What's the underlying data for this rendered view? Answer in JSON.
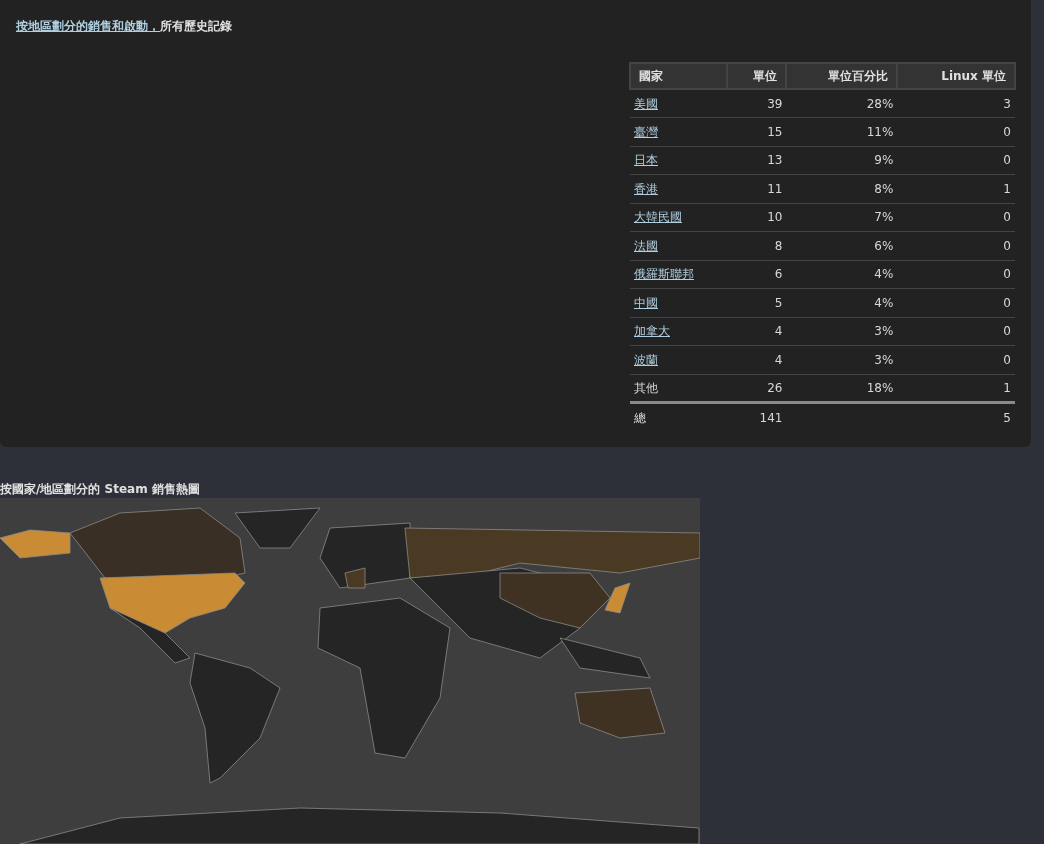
{
  "sales_panel": {
    "title_link": "按地區劃分的銷售和啟動，",
    "title_rest": "所有歷史記錄",
    "table": {
      "columns": [
        "國家",
        "單位",
        "單位百分比",
        "Linux 單位"
      ],
      "rows": [
        {
          "country": "美國",
          "link": true,
          "units": "39",
          "percent": "28%",
          "linux": "3"
        },
        {
          "country": "臺灣",
          "link": true,
          "units": "15",
          "percent": "11%",
          "linux": "0"
        },
        {
          "country": "日本",
          "link": true,
          "units": "13",
          "percent": "9%",
          "linux": "0"
        },
        {
          "country": "香港",
          "link": true,
          "units": "11",
          "percent": "8%",
          "linux": "1"
        },
        {
          "country": "大韓民國",
          "link": true,
          "units": "10",
          "percent": "7%",
          "linux": "0"
        },
        {
          "country": "法國",
          "link": true,
          "units": "8",
          "percent": "6%",
          "linux": "0"
        },
        {
          "country": "俄羅斯聯邦",
          "link": true,
          "units": "6",
          "percent": "4%",
          "linux": "0"
        },
        {
          "country": "中國",
          "link": true,
          "units": "5",
          "percent": "4%",
          "linux": "0"
        },
        {
          "country": "加拿大",
          "link": true,
          "units": "4",
          "percent": "3%",
          "linux": "0"
        },
        {
          "country": "波蘭",
          "link": true,
          "units": "4",
          "percent": "3%",
          "linux": "0"
        },
        {
          "country": "其他",
          "link": false,
          "units": "26",
          "percent": "18%",
          "linux": "1"
        }
      ],
      "total": {
        "label": "總",
        "units": "141",
        "linux": "5"
      }
    }
  },
  "heatmap": {
    "title": "按國家/地區劃分的 Steam 銷售熱圖"
  }
}
